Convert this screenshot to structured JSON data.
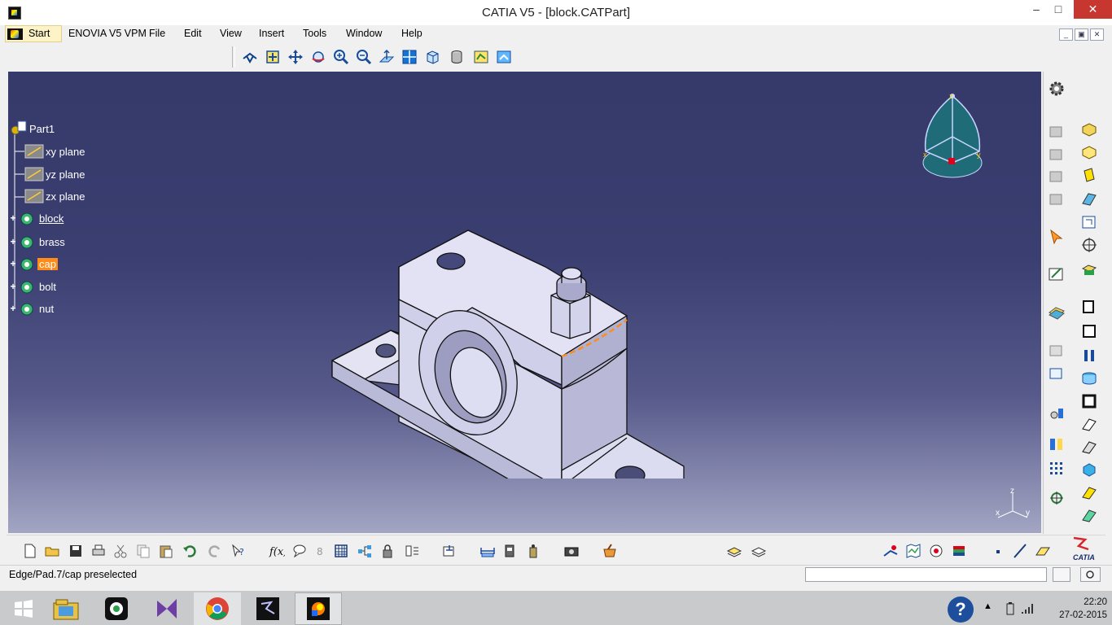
{
  "window": {
    "title": "CATIA V5 - [block.CATPart]",
    "controls": {
      "minimize": "–",
      "maximize": "□",
      "close": "✕"
    }
  },
  "menubar": {
    "items": [
      "Start",
      "ENOVIA V5 VPM",
      "File",
      "Edit",
      "View",
      "Insert",
      "Tools",
      "Window",
      "Help"
    ]
  },
  "mdi_controls": {
    "minimize": "_",
    "restore": "▣",
    "close": "✕"
  },
  "toolbar_top": {
    "icons": [
      "fly-mode-icon",
      "fit-all-in-icon",
      "pan-icon",
      "rotate-icon",
      "zoom-in-icon",
      "zoom-out-icon",
      "normal-view-icon",
      "multi-view-icon",
      "iso-view-icon",
      "shading-icon",
      "hide-show-icon",
      "swap-visible-space-icon"
    ]
  },
  "spec_tree": {
    "root": "Part1",
    "planes": [
      "xy plane",
      "yz plane",
      "zx plane"
    ],
    "bodies": [
      {
        "label": "block",
        "state": "underlined"
      },
      {
        "label": "brass",
        "state": "normal"
      },
      {
        "label": "cap",
        "state": "selected"
      },
      {
        "label": "bolt",
        "state": "normal"
      },
      {
        "label": "nut",
        "state": "normal"
      }
    ]
  },
  "compass": {
    "axes": [
      "z",
      "x",
      "y"
    ]
  },
  "axis_triad": {
    "axes": [
      "z",
      "x",
      "y"
    ]
  },
  "status": {
    "message": "Edge/Pad.7/cap preselected",
    "command_input_value": ""
  },
  "brand": {
    "logo_text": "CATIA",
    "ds_mark": "3DS"
  },
  "taskbar": {
    "apps": [
      "windows-start",
      "file-explorer",
      "media-app",
      "visual-studio",
      "chrome",
      "3ds-app",
      "catia-app"
    ],
    "time": "22:20",
    "date": "27-02-2015",
    "help": "?"
  },
  "colors": {
    "viewport_top": "#363a6a",
    "viewport_bottom": "#a3a5c3",
    "selection": "#ff8c1a",
    "part_face": "#d9d9ef",
    "close_button": "#c7372f"
  }
}
